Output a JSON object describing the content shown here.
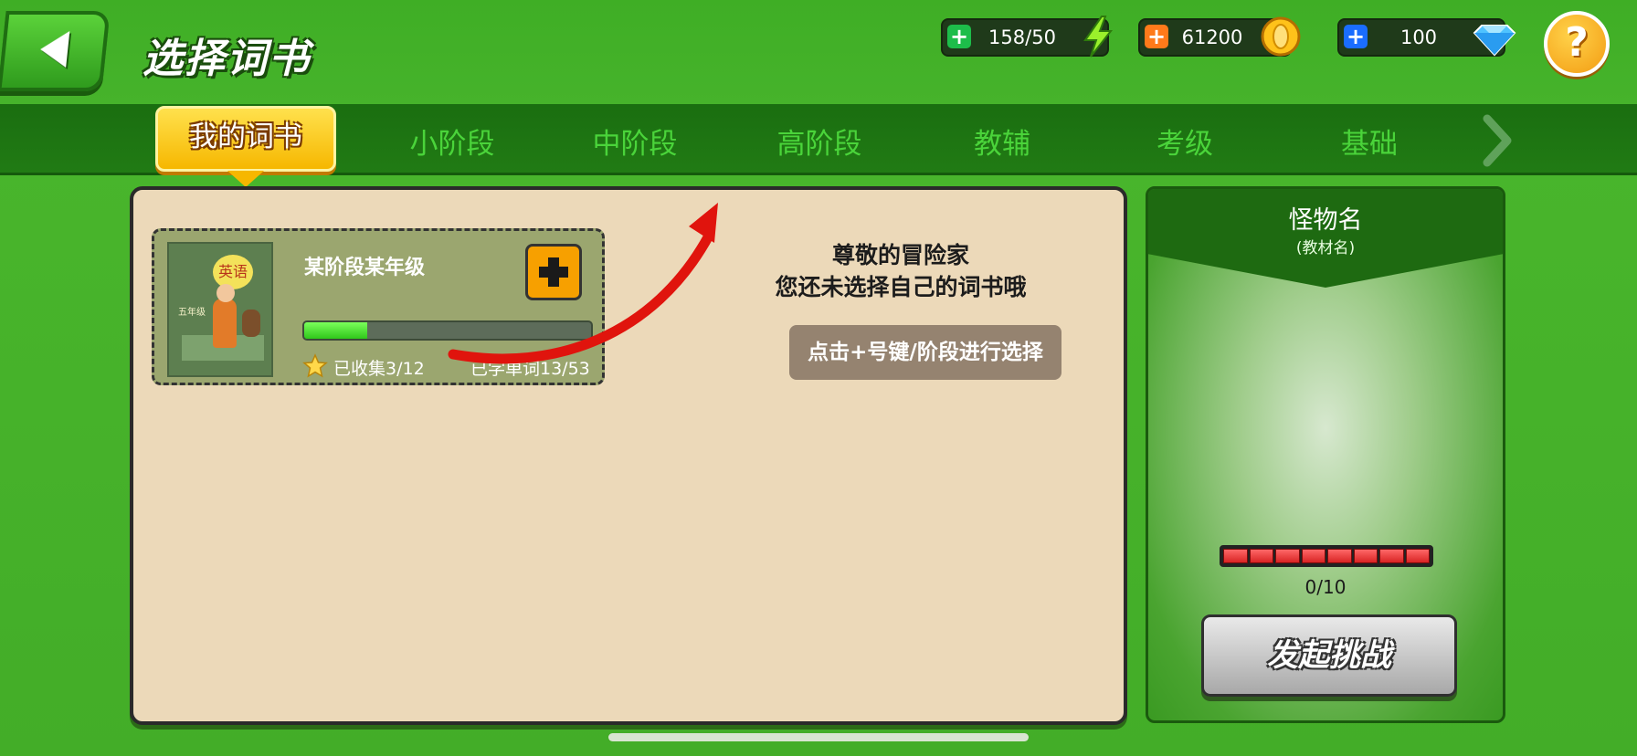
{
  "header": {
    "title": "选择词书",
    "resources": [
      {
        "name": "energy",
        "value": "158/50",
        "plus_color": "#1dbd4a",
        "icon": "lightning-icon"
      },
      {
        "name": "gold",
        "value": "61200",
        "plus_color": "#ff7a1a",
        "icon": "coin-icon"
      },
      {
        "name": "gem",
        "value": "100",
        "plus_color": "#1a6dff",
        "icon": "diamond-icon"
      }
    ],
    "plus_symbol": "+",
    "help_symbol": "?"
  },
  "tabs": {
    "active": "我的词书",
    "items": [
      "小阶段",
      "中阶段",
      "高阶段",
      "教辅",
      "考级",
      "基础"
    ]
  },
  "book": {
    "cover_text": "英语",
    "cover_note": "五年级",
    "title": "某阶段某年级",
    "progress": 0.22,
    "collected": "已收集3/12",
    "learned": "已学单词13/53"
  },
  "message": {
    "line1": "尊敬的冒险家",
    "line2": "您还未选择自己的词书哦",
    "hint_button": "点击+号键/阶段进行选择"
  },
  "monster": {
    "name": "怪物名",
    "textbook": "(教材名)",
    "hp_text": "0/10",
    "hp_segments": 8,
    "challenge_button": "发起挑战"
  },
  "colors": {
    "accent_yellow": "#f6b700",
    "tab_text": "#4ad43a",
    "arrow_red": "#e0140d"
  }
}
